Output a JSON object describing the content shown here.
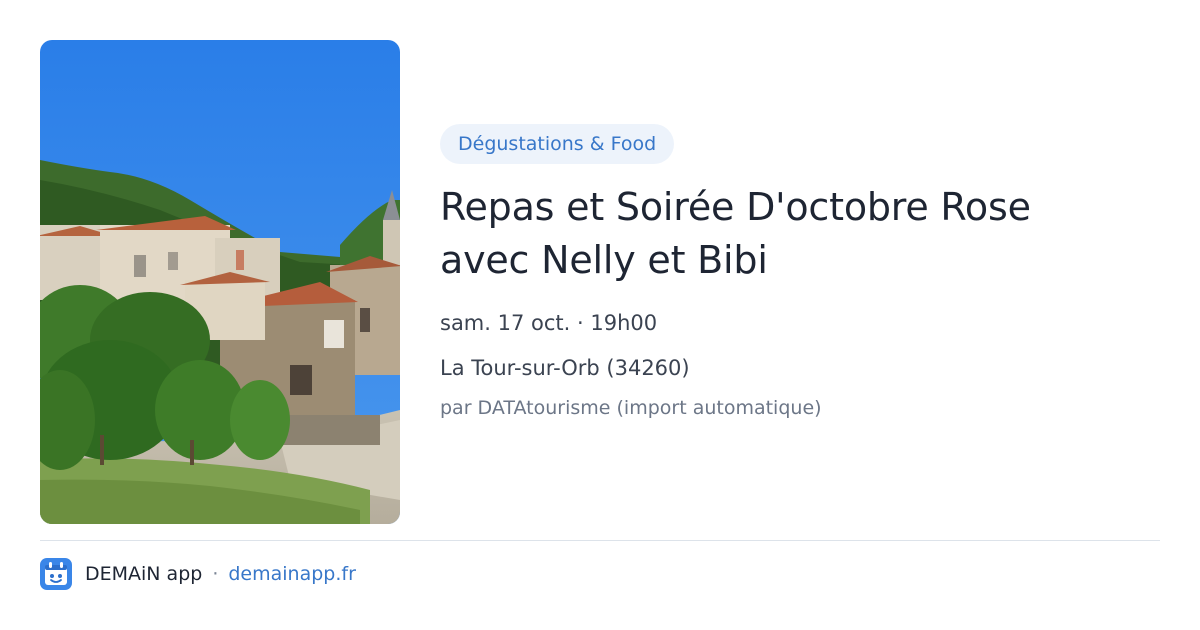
{
  "event": {
    "category": "Dégustations & Food",
    "title_line1": "Repas et Soirée D'octobre Rose",
    "title_line2": "avec Nelly et Bibi",
    "datetime": "sam. 17 oct. · 19h00",
    "location": "La Tour-sur-Orb (34260)",
    "source": "par DATAtourisme (import automatique)"
  },
  "footer": {
    "app_name": "DEMAiN app",
    "separator": "·",
    "site": "demainapp.fr"
  },
  "colors": {
    "accent": "#3877c9",
    "chip_background": "#edf3fb",
    "title": "#1e2533",
    "secondary_text": "#3b4351",
    "muted_text": "#6c7687",
    "divider": "#dde3ea"
  },
  "icons": {
    "app_logo": "demain-app-logo-icon"
  }
}
